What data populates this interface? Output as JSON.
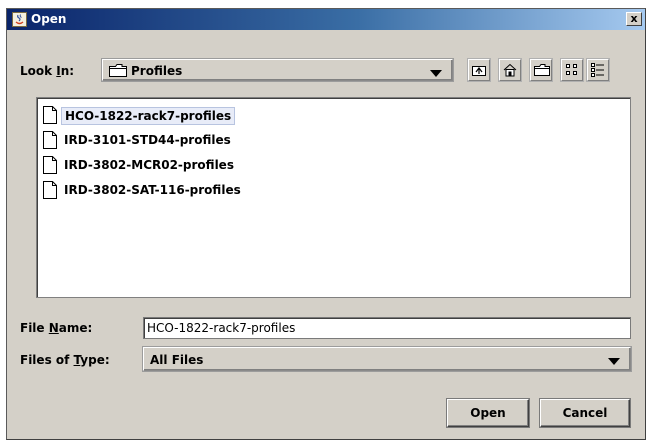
{
  "window": {
    "title": "Open",
    "close_label": "x"
  },
  "look_in": {
    "label_prefix": "Look ",
    "label_mnemonic": "I",
    "label_suffix": "n:",
    "value": "Profiles"
  },
  "toolbar": {
    "buttons": [
      "up-one-level",
      "home",
      "new-folder",
      "list-view",
      "details-view"
    ]
  },
  "files": [
    {
      "name": "HCO-1822-rack7-profiles",
      "selected": true
    },
    {
      "name": "IRD-3101-STD44-profiles",
      "selected": false
    },
    {
      "name": "IRD-3802-MCR02-profiles",
      "selected": false
    },
    {
      "name": "IRD-3802-SAT-116-profiles",
      "selected": false
    }
  ],
  "file_name": {
    "label_prefix": "File ",
    "label_mnemonic": "N",
    "label_suffix": "ame:",
    "value": "HCO-1822-rack7-profiles"
  },
  "file_type": {
    "label_prefix": "Files of ",
    "label_mnemonic": "T",
    "label_suffix": "ype:",
    "value": "All Files"
  },
  "buttons": {
    "open": "Open",
    "cancel": "Cancel"
  },
  "colors": {
    "title_gradient_start": "#0a246a",
    "dialog_bg": "#d4d0c8"
  }
}
